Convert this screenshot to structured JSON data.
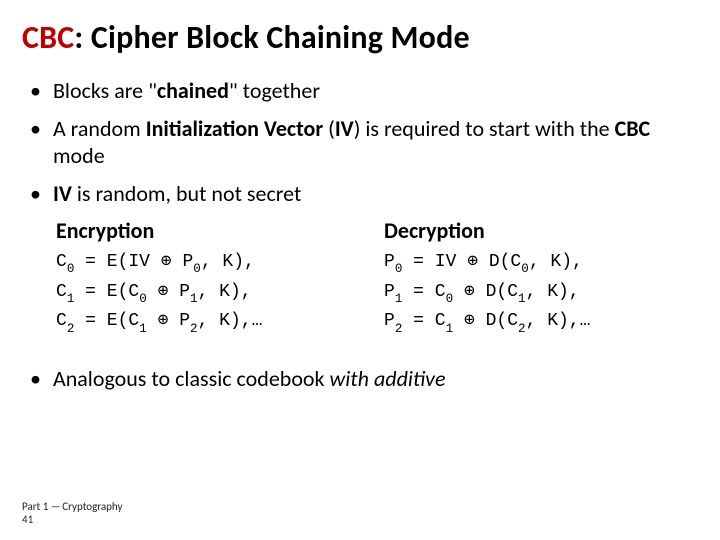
{
  "title": {
    "prefix": "CBC",
    "rest": ": Cipher Block Chaining Mode"
  },
  "bullets": {
    "b1": {
      "pre": "Blocks are \"",
      "bold": "chained",
      "post": "\" together"
    },
    "b2": {
      "a": "A random ",
      "iv_label": "Initialization Vector",
      "paren_open": " (",
      "iv": "IV",
      "paren_close": ") is required to start with the ",
      "cbc": "CBC",
      "tail": " mode"
    },
    "b3": {
      "iv": "IV",
      "rest": " is random, but not secret"
    },
    "b4": {
      "a": "Analogous to classic codebook ",
      "ital": "with additive"
    }
  },
  "enc": {
    "head": "Encryption",
    "lines": [
      {
        "lhs": "C",
        "lsub": "0",
        "eq": " = E(IV ",
        "xor": "⊕",
        "mid": " P",
        "msub": "0",
        "tail": ", K),"
      },
      {
        "lhs": "C",
        "lsub": "1",
        "eq": " = E(C",
        "asub": "0",
        "sp": "  ",
        "xor": "⊕",
        "mid": " P",
        "msub": "1",
        "tail": ", K),"
      },
      {
        "lhs": "C",
        "lsub": "2",
        "eq": " = E(C",
        "asub": "1",
        "sp": "  ",
        "xor": "⊕",
        "mid": " P",
        "msub": "2",
        "tail": ", K),…"
      }
    ]
  },
  "dec": {
    "head": "Decryption",
    "lines": [
      {
        "lhs": "P",
        "lsub": "0",
        "eq": " = IV ",
        "xor": "⊕",
        "mid": " D(C",
        "msub": "0",
        "tail": ", K),"
      },
      {
        "lhs": "P",
        "lsub": "1",
        "eq": " = C",
        "asub": "0",
        "sp": "  ",
        "xor": "⊕",
        "mid": " D(C",
        "msub": "1",
        "tail": ", K),"
      },
      {
        "lhs": "P",
        "lsub": "2",
        "eq": " = C",
        "asub": "1",
        "sp": "  ",
        "xor": "⊕",
        "mid": " D(C",
        "msub": "2",
        "tail": ", K),…"
      }
    ]
  },
  "footer": {
    "line1a": "Part 1 ",
    "dash": "—",
    "line1b": " Cryptography",
    "line2": "41"
  }
}
